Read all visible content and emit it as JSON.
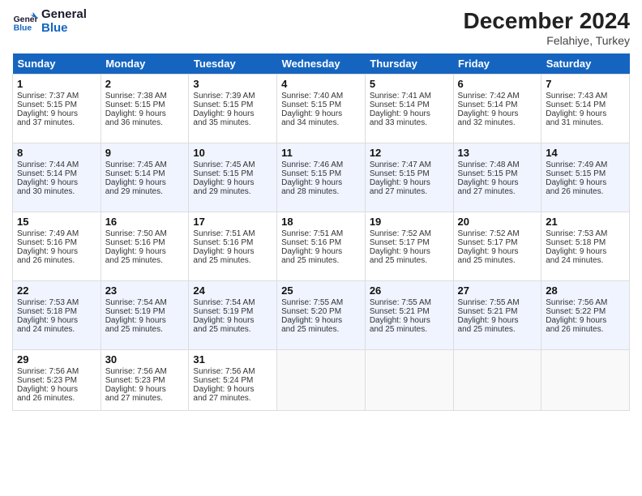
{
  "header": {
    "logo_line1": "General",
    "logo_line2": "Blue",
    "month": "December 2024",
    "location": "Felahiye, Turkey"
  },
  "days_of_week": [
    "Sunday",
    "Monday",
    "Tuesday",
    "Wednesday",
    "Thursday",
    "Friday",
    "Saturday"
  ],
  "weeks": [
    [
      {
        "day": "1",
        "lines": [
          "Sunrise: 7:37 AM",
          "Sunset: 5:15 PM",
          "Daylight: 9 hours",
          "and 37 minutes."
        ]
      },
      {
        "day": "2",
        "lines": [
          "Sunrise: 7:38 AM",
          "Sunset: 5:15 PM",
          "Daylight: 9 hours",
          "and 36 minutes."
        ]
      },
      {
        "day": "3",
        "lines": [
          "Sunrise: 7:39 AM",
          "Sunset: 5:15 PM",
          "Daylight: 9 hours",
          "and 35 minutes."
        ]
      },
      {
        "day": "4",
        "lines": [
          "Sunrise: 7:40 AM",
          "Sunset: 5:15 PM",
          "Daylight: 9 hours",
          "and 34 minutes."
        ]
      },
      {
        "day": "5",
        "lines": [
          "Sunrise: 7:41 AM",
          "Sunset: 5:14 PM",
          "Daylight: 9 hours",
          "and 33 minutes."
        ]
      },
      {
        "day": "6",
        "lines": [
          "Sunrise: 7:42 AM",
          "Sunset: 5:14 PM",
          "Daylight: 9 hours",
          "and 32 minutes."
        ]
      },
      {
        "day": "7",
        "lines": [
          "Sunrise: 7:43 AM",
          "Sunset: 5:14 PM",
          "Daylight: 9 hours",
          "and 31 minutes."
        ]
      }
    ],
    [
      {
        "day": "8",
        "lines": [
          "Sunrise: 7:44 AM",
          "Sunset: 5:14 PM",
          "Daylight: 9 hours",
          "and 30 minutes."
        ]
      },
      {
        "day": "9",
        "lines": [
          "Sunrise: 7:45 AM",
          "Sunset: 5:14 PM",
          "Daylight: 9 hours",
          "and 29 minutes."
        ]
      },
      {
        "day": "10",
        "lines": [
          "Sunrise: 7:45 AM",
          "Sunset: 5:15 PM",
          "Daylight: 9 hours",
          "and 29 minutes."
        ]
      },
      {
        "day": "11",
        "lines": [
          "Sunrise: 7:46 AM",
          "Sunset: 5:15 PM",
          "Daylight: 9 hours",
          "and 28 minutes."
        ]
      },
      {
        "day": "12",
        "lines": [
          "Sunrise: 7:47 AM",
          "Sunset: 5:15 PM",
          "Daylight: 9 hours",
          "and 27 minutes."
        ]
      },
      {
        "day": "13",
        "lines": [
          "Sunrise: 7:48 AM",
          "Sunset: 5:15 PM",
          "Daylight: 9 hours",
          "and 27 minutes."
        ]
      },
      {
        "day": "14",
        "lines": [
          "Sunrise: 7:49 AM",
          "Sunset: 5:15 PM",
          "Daylight: 9 hours",
          "and 26 minutes."
        ]
      }
    ],
    [
      {
        "day": "15",
        "lines": [
          "Sunrise: 7:49 AM",
          "Sunset: 5:16 PM",
          "Daylight: 9 hours",
          "and 26 minutes."
        ]
      },
      {
        "day": "16",
        "lines": [
          "Sunrise: 7:50 AM",
          "Sunset: 5:16 PM",
          "Daylight: 9 hours",
          "and 25 minutes."
        ]
      },
      {
        "day": "17",
        "lines": [
          "Sunrise: 7:51 AM",
          "Sunset: 5:16 PM",
          "Daylight: 9 hours",
          "and 25 minutes."
        ]
      },
      {
        "day": "18",
        "lines": [
          "Sunrise: 7:51 AM",
          "Sunset: 5:16 PM",
          "Daylight: 9 hours",
          "and 25 minutes."
        ]
      },
      {
        "day": "19",
        "lines": [
          "Sunrise: 7:52 AM",
          "Sunset: 5:17 PM",
          "Daylight: 9 hours",
          "and 25 minutes."
        ]
      },
      {
        "day": "20",
        "lines": [
          "Sunrise: 7:52 AM",
          "Sunset: 5:17 PM",
          "Daylight: 9 hours",
          "and 25 minutes."
        ]
      },
      {
        "day": "21",
        "lines": [
          "Sunrise: 7:53 AM",
          "Sunset: 5:18 PM",
          "Daylight: 9 hours",
          "and 24 minutes."
        ]
      }
    ],
    [
      {
        "day": "22",
        "lines": [
          "Sunrise: 7:53 AM",
          "Sunset: 5:18 PM",
          "Daylight: 9 hours",
          "and 24 minutes."
        ]
      },
      {
        "day": "23",
        "lines": [
          "Sunrise: 7:54 AM",
          "Sunset: 5:19 PM",
          "Daylight: 9 hours",
          "and 25 minutes."
        ]
      },
      {
        "day": "24",
        "lines": [
          "Sunrise: 7:54 AM",
          "Sunset: 5:19 PM",
          "Daylight: 9 hours",
          "and 25 minutes."
        ]
      },
      {
        "day": "25",
        "lines": [
          "Sunrise: 7:55 AM",
          "Sunset: 5:20 PM",
          "Daylight: 9 hours",
          "and 25 minutes."
        ]
      },
      {
        "day": "26",
        "lines": [
          "Sunrise: 7:55 AM",
          "Sunset: 5:21 PM",
          "Daylight: 9 hours",
          "and 25 minutes."
        ]
      },
      {
        "day": "27",
        "lines": [
          "Sunrise: 7:55 AM",
          "Sunset: 5:21 PM",
          "Daylight: 9 hours",
          "and 25 minutes."
        ]
      },
      {
        "day": "28",
        "lines": [
          "Sunrise: 7:56 AM",
          "Sunset: 5:22 PM",
          "Daylight: 9 hours",
          "and 26 minutes."
        ]
      }
    ],
    [
      {
        "day": "29",
        "lines": [
          "Sunrise: 7:56 AM",
          "Sunset: 5:23 PM",
          "Daylight: 9 hours",
          "and 26 minutes."
        ]
      },
      {
        "day": "30",
        "lines": [
          "Sunrise: 7:56 AM",
          "Sunset: 5:23 PM",
          "Daylight: 9 hours",
          "and 27 minutes."
        ]
      },
      {
        "day": "31",
        "lines": [
          "Sunrise: 7:56 AM",
          "Sunset: 5:24 PM",
          "Daylight: 9 hours",
          "and 27 minutes."
        ]
      },
      {
        "day": "",
        "lines": []
      },
      {
        "day": "",
        "lines": []
      },
      {
        "day": "",
        "lines": []
      },
      {
        "day": "",
        "lines": []
      }
    ]
  ]
}
